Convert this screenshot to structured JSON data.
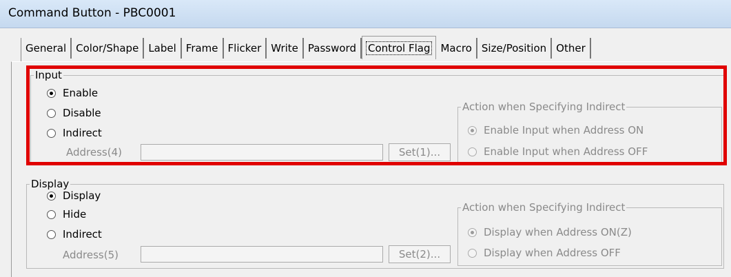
{
  "window": {
    "title": "Command Button - PBC0001"
  },
  "tabs": [
    {
      "label": "General"
    },
    {
      "label": "Color/Shape"
    },
    {
      "label": "Label"
    },
    {
      "label": "Frame"
    },
    {
      "label": "Flicker"
    },
    {
      "label": "Write"
    },
    {
      "label": "Password"
    },
    {
      "label": "Control Flag"
    },
    {
      "label": "Macro"
    },
    {
      "label": "Size/Position"
    },
    {
      "label": "Other"
    }
  ],
  "active_tab": "Control Flag",
  "input": {
    "legend": "Input",
    "options": [
      {
        "label": "Enable"
      },
      {
        "label": "Disable"
      },
      {
        "label": "Indirect"
      }
    ],
    "selected": "Enable",
    "address_label": "Address(4)",
    "address_value": "",
    "set_label": "Set(1)...",
    "action": {
      "legend": "Action when Specifying Indirect",
      "options": [
        {
          "label": "Enable Input when Address ON"
        },
        {
          "label": "Enable Input when Address OFF"
        }
      ],
      "selected": "Enable Input when Address ON"
    }
  },
  "display": {
    "legend": "Display",
    "options": [
      {
        "label": "Display"
      },
      {
        "label": "Hide"
      },
      {
        "label": "Indirect"
      }
    ],
    "selected": "Display",
    "address_label": "Address(5)",
    "address_value": "",
    "set_label": "Set(2)...",
    "action": {
      "legend": "Action when Specifying Indirect",
      "options": [
        {
          "label": "Display when Address ON(Z)"
        },
        {
          "label": "Display when Address OFF"
        }
      ],
      "selected": "Display when Address ON(Z)"
    }
  },
  "colors": {
    "highlight": "#e00000",
    "titlebar": "#c5d9ef"
  }
}
